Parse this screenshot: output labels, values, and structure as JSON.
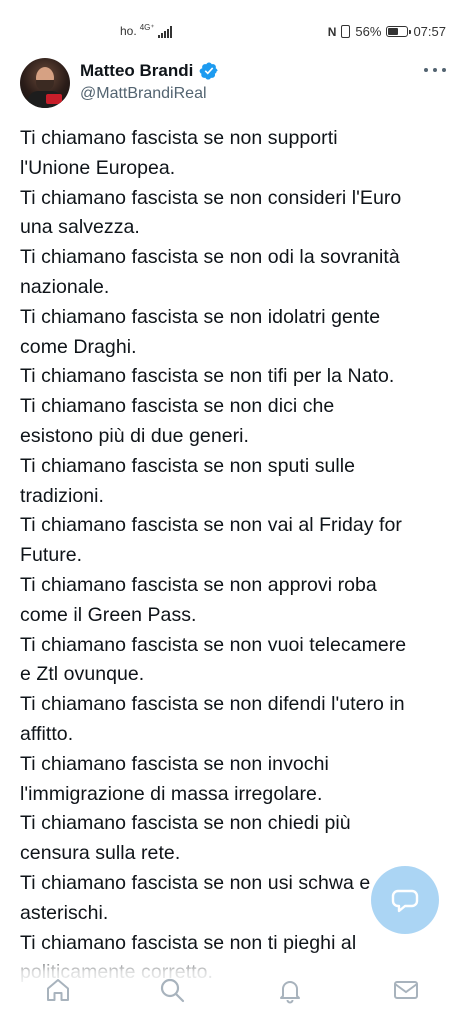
{
  "status_bar": {
    "carrier": "ho.",
    "network": "4G⁺",
    "battery_percent": "56%",
    "battery_level": 0.56,
    "time": "07:57"
  },
  "tweet": {
    "author_name": "Matteo Brandi",
    "author_handle": "@MattBrandiReal",
    "verified": true,
    "lines": [
      "Ti chiamano fascista se non supporti",
      "l'Unione Europea.",
      "Ti chiamano fascista se non consideri l'Euro",
      "una salvezza.",
      "Ti chiamano fascista se non odi la sovranità",
      "nazionale.",
      "Ti chiamano fascista se non idolatri gente",
      "come Draghi.",
      "Ti chiamano fascista se non tifi per la Nato.",
      "Ti chiamano fascista se non dici che",
      "esistono più di due generi.",
      "Ti chiamano fascista se non sputi sulle",
      "tradizioni.",
      "Ti chiamano fascista se non vai al Friday for",
      "Future.",
      "Ti chiamano fascista se non approvi roba",
      "come il Green Pass.",
      "Ti chiamano fascista se non vuoi telecamere",
      "e Ztl ovunque.",
      "Ti chiamano fascista se non difendi l'utero in",
      "affitto.",
      "Ti chiamano fascista se non invochi",
      "l'immigrazione di massa irregolare.",
      "Ti chiamano fascista se non chiedi più",
      "censura sulla rete.",
      "Ti chiamano fascista se non usi schwa e",
      "asterischi.",
      "Ti chiamano fascista se non ti pieghi al",
      "politicamente corretto."
    ]
  },
  "colors": {
    "verified_blue": "#1d9bf0",
    "text_primary": "#0f1419",
    "text_secondary": "#536471",
    "fab_blue": "#87c3f0"
  },
  "bottom_nav": {
    "items": [
      {
        "icon": "home-icon"
      },
      {
        "icon": "search-icon"
      },
      {
        "icon": "bell-icon"
      },
      {
        "icon": "mail-icon"
      }
    ]
  },
  "compose": {
    "icon": "compose-icon"
  }
}
